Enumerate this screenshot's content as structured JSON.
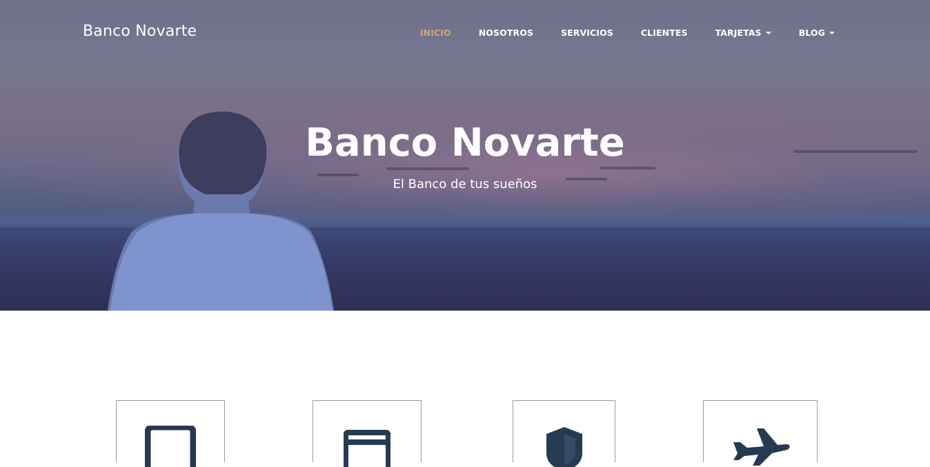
{
  "brand": "Banco Novarte",
  "nav": {
    "items": [
      {
        "label": "INICIO",
        "active": true
      },
      {
        "label": "NOSOTROS"
      },
      {
        "label": "SERVICIOS"
      },
      {
        "label": "CLIENTES"
      },
      {
        "label": "TARJETAS",
        "dropdown": true
      },
      {
        "label": "BLOG",
        "dropdown": true
      }
    ]
  },
  "hero": {
    "title": "Banco Novarte",
    "subtitle": "El Banco de tus sueños"
  },
  "features": [
    {
      "icon": "tablet-icon"
    },
    {
      "icon": "credit-card-icon"
    },
    {
      "icon": "shield-icon"
    },
    {
      "icon": "airplane-icon"
    }
  ],
  "colors": {
    "active_nav": "#d8a572",
    "icon": "#263a52"
  }
}
